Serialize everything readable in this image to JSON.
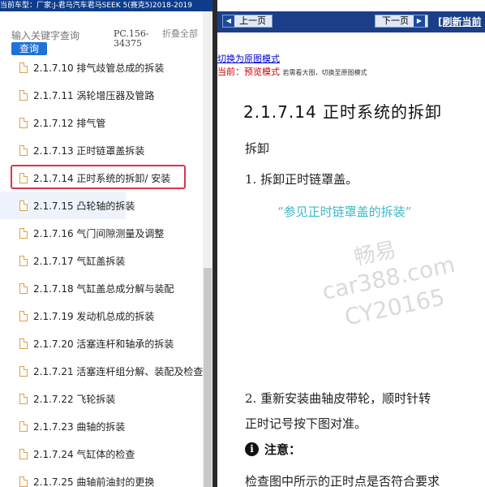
{
  "header": {
    "vehicle_line": "当前车型：厂家:J-君马汽车君马SEEK 5(赛克5)2018-2019"
  },
  "search": {
    "placeholder": "输入关键字查询",
    "button_label": "查询",
    "pc_code": "PC.156-34375",
    "collapse_all": "折叠全部"
  },
  "tree": {
    "items": [
      {
        "label": "2.1.7.10 排气歧管总成的拆装"
      },
      {
        "label": "2.1.7.11 涡轮增压器及管路"
      },
      {
        "label": "2.1.7.12 排气管"
      },
      {
        "label": "2.1.7.13 正时链罩盖拆装"
      },
      {
        "label": "2.1.7.14 正时系统的拆卸/ 安装"
      },
      {
        "label": "2.1.7.15 凸轮轴的拆装"
      },
      {
        "label": "2.1.7.16 气门间隙测量及调整"
      },
      {
        "label": "2.1.7.17 气缸盖拆装"
      },
      {
        "label": "2.1.7.18 气缸盖总成分解与装配"
      },
      {
        "label": "2.1.7.19 发动机总成的拆装"
      },
      {
        "label": "2.1.7.20 活塞连杆和轴承的拆装"
      },
      {
        "label": "2.1.7.21 活塞连杆组分解、装配及检查"
      },
      {
        "label": "2.1.7.22 飞轮拆装"
      },
      {
        "label": "2.1.7.23 曲轴的拆装"
      },
      {
        "label": "2.1.7.24 气缸体的检查"
      },
      {
        "label": "2.1.7.25 曲轴前油封的更换"
      }
    ]
  },
  "nav": {
    "prev_label": "上一页",
    "next_label": "下一页",
    "refresh_label": "[刷新当前"
  },
  "doc": {
    "switch_link": "切换为原图模式",
    "current_prefix": "当前：",
    "current_mode": "预览模式",
    "current_hint": "若需看大图，切换至原图模式",
    "title": "2.1.7.14 正时系统的拆卸",
    "section_removal": "拆卸",
    "step1": "1.   拆卸正时链罩盖。",
    "ref_text": "“参见正时链罩盖的拆装”",
    "step2_line1": "2.   重新安装曲轴皮带轮，顺时针转",
    "step2_line2": "正时记号按下图对准。",
    "note_label": "注意：",
    "note_text": "检查图中所示的正时点是否符合要求"
  },
  "watermark": {
    "line1": "畅易",
    "line2": "car388.com",
    "line3": "CY20165"
  },
  "colors": {
    "header_bg": "#0d3c8c",
    "nav_bg": "#1a3f88",
    "search_button": "#1e72d8",
    "highlight_border": "#e0334c",
    "link_blue": "#0000cc",
    "mode_red": "#d00000",
    "ref_cyan": "#3cb8c9"
  }
}
